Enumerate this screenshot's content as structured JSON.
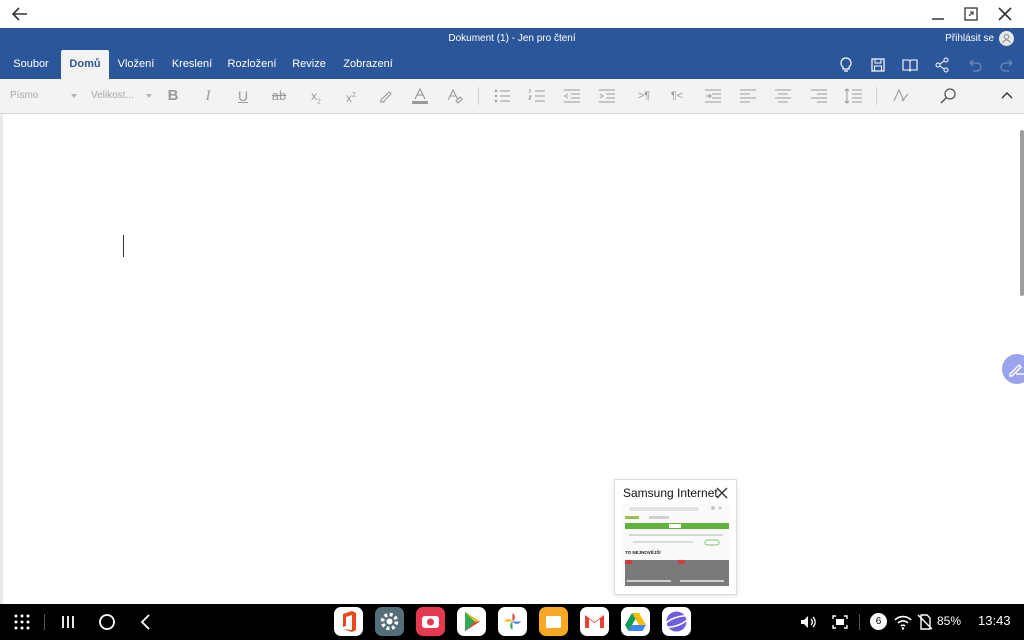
{
  "window": {
    "title": "Dokument (1) - Jen pro čtení",
    "signin": "Přihlásit se"
  },
  "tabs": [
    {
      "label": "Soubor",
      "active": false
    },
    {
      "label": "Domů",
      "active": true
    },
    {
      "label": "Vložení",
      "active": false
    },
    {
      "label": "Kreslení",
      "active": false
    },
    {
      "label": "Rozložení",
      "active": false
    },
    {
      "label": "Revize",
      "active": false
    },
    {
      "label": "Zobrazení",
      "active": false
    }
  ],
  "ribbon": {
    "font_placeholder": "Písmo",
    "size_placeholder": "Velikost..."
  },
  "recent_popup": {
    "app_name": "Samsung Internet",
    "thumb_heading": "TO NEJNOVĚJŠÍ"
  },
  "taskbar": {
    "notification_count": "6",
    "battery": "85%",
    "time": "13:43"
  },
  "colors": {
    "brand": "#2b579a",
    "ribbon_bg": "#f3f3f3"
  }
}
